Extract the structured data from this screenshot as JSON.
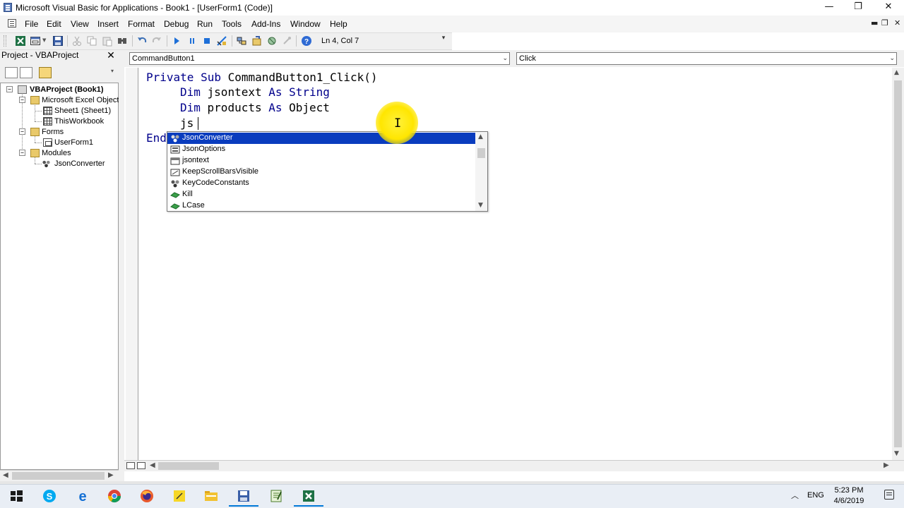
{
  "window": {
    "title": "Microsoft Visual Basic for Applications - Book1 - [UserForm1 (Code)]",
    "minimize_glyph": "—",
    "restore_glyph": "❐",
    "close_glyph": "✕"
  },
  "menubar": {
    "items": [
      {
        "label": "File"
      },
      {
        "label": "Edit"
      },
      {
        "label": "View"
      },
      {
        "label": "Insert"
      },
      {
        "label": "Format"
      },
      {
        "label": "Debug"
      },
      {
        "label": "Run"
      },
      {
        "label": "Tools"
      },
      {
        "label": "Add-Ins"
      },
      {
        "label": "Window"
      },
      {
        "label": "Help"
      }
    ],
    "mdi_minimize": "▬",
    "mdi_restore": "❐",
    "mdi_close": "✕"
  },
  "toolbar": {
    "position": "Ln 4, Col 7",
    "icons": [
      "excel-icon",
      "insert-userform-icon",
      "save-icon",
      "cut-icon",
      "copy-icon",
      "paste-icon",
      "find-icon",
      "undo-icon",
      "redo-icon",
      "run-icon",
      "break-icon",
      "reset-icon",
      "design-mode-icon",
      "project-explorer-icon",
      "properties-icon",
      "object-browser-icon",
      "toolbox-icon",
      "help-icon"
    ]
  },
  "project": {
    "title": "Project - VBAProject",
    "close_glyph": "✕",
    "tree": [
      {
        "label": "VBAProject (Book1)",
        "icon": "vba-project-icon"
      },
      {
        "label": "Microsoft Excel Objects",
        "icon": "folder-icon"
      },
      {
        "label": "Sheet1 (Sheet1)",
        "icon": "sheet-icon"
      },
      {
        "label": "ThisWorkbook",
        "icon": "workbook-icon"
      },
      {
        "label": "Forms",
        "icon": "folder-icon"
      },
      {
        "label": "UserForm1",
        "icon": "userform-icon"
      },
      {
        "label": "Modules",
        "icon": "folder-icon"
      },
      {
        "label": "JsonConverter",
        "icon": "module-icon"
      }
    ]
  },
  "code": {
    "object_combo": "CommandButton1",
    "procedure_combo": "Click",
    "lines": {
      "l1_kw1": "Private",
      "l1_kw2": "Sub",
      "l1_rest": " CommandButton1_Click()",
      "l2_kw1": "Dim",
      "l2_mid": " jsontext ",
      "l2_kw2": "As",
      "l2_kw3": "String",
      "l3_kw1": "Dim",
      "l3_mid": " products ",
      "l3_kw2": "As",
      "l3_rest": " Object",
      "l4_text": "js",
      "l5_text": "End"
    }
  },
  "autocomplete": {
    "items": [
      {
        "label": "JsonConverter",
        "icon": "module-icon",
        "selected": true
      },
      {
        "label": "JsonOptions",
        "icon": "class-icon",
        "selected": false
      },
      {
        "label": "jsontext",
        "icon": "variable-icon",
        "selected": false
      },
      {
        "label": "KeepScrollBarsVisible",
        "icon": "property-icon",
        "selected": false
      },
      {
        "label": "KeyCodeConstants",
        "icon": "module-icon",
        "selected": false
      },
      {
        "label": "Kill",
        "icon": "method-icon",
        "selected": false
      },
      {
        "label": "LCase",
        "icon": "method-icon",
        "selected": false
      }
    ]
  },
  "taskbar": {
    "apps": [
      "windows-start-icon",
      "skype-icon",
      "edge-icon",
      "chrome-icon",
      "firefox-icon",
      "sticky-notes-icon",
      "file-explorer-icon",
      "vba-save-icon",
      "notepad-icon",
      "excel-icon"
    ],
    "lang": "ENG",
    "time": "5:23 PM",
    "date": "4/6/2019"
  },
  "colors": {
    "keyword": "#00008b",
    "selection": "#0a3cbe",
    "cursor_highlight": "#ffe600",
    "taskbar_active": "#0078d7"
  }
}
